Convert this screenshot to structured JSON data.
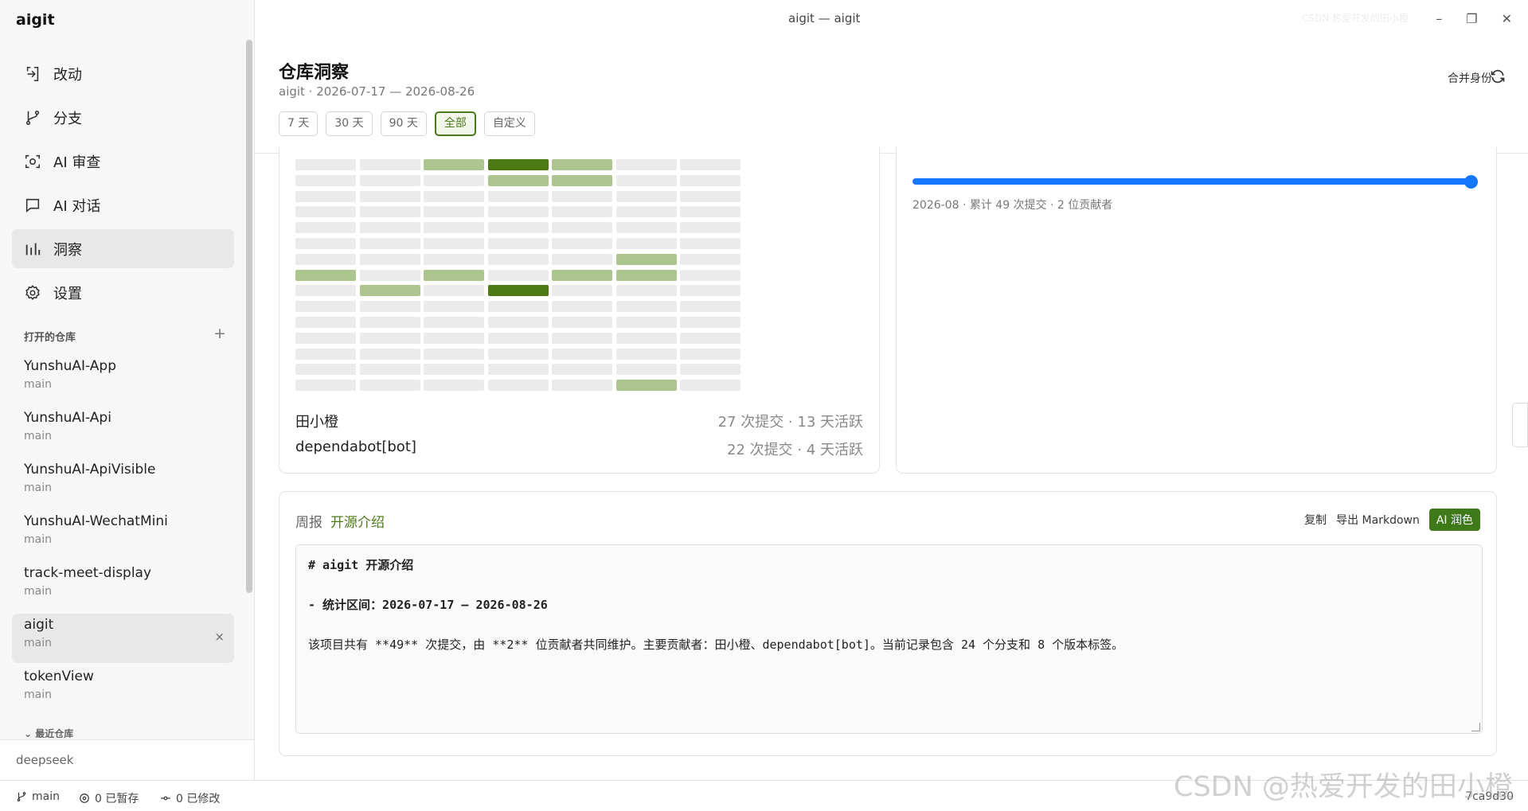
{
  "app": {
    "brand": "aigit",
    "window_title": "aigit — aigit",
    "ghost_text": "CSDN·热爱开发的田小橙"
  },
  "nav": [
    {
      "label": "改动",
      "icon": "changes-icon"
    },
    {
      "label": "分支",
      "icon": "branch-icon"
    },
    {
      "label": "AI 审查",
      "icon": "ai-review-icon"
    },
    {
      "label": "AI 对话",
      "icon": "chat-icon"
    },
    {
      "label": "洞察",
      "icon": "chart-icon",
      "active": true
    },
    {
      "label": "设置",
      "icon": "gear-icon"
    }
  ],
  "repos": {
    "heading": "打开的仓库",
    "add_label": "+",
    "items": [
      {
        "name": "YunshuAI-App",
        "branch": "main"
      },
      {
        "name": "YunshuAI-Api",
        "branch": "main"
      },
      {
        "name": "YunshuAI-ApiVisible",
        "branch": "main"
      },
      {
        "name": "YunshuAI-WechatMini",
        "branch": "main"
      },
      {
        "name": "track-meet-display",
        "branch": "main"
      },
      {
        "name": "aigit",
        "branch": "main",
        "active": true,
        "close": "×"
      },
      {
        "name": "tokenView",
        "branch": "main"
      }
    ],
    "recent": "最近仓库"
  },
  "model": "deepseek",
  "header": {
    "title": "仓库洞察",
    "subtitle": "aigit · 2026-07-17 — 2026-08-26",
    "ranges": [
      "7 天",
      "30 天",
      "90 天",
      "全部",
      "自定义"
    ],
    "active_range": 3,
    "identity": "合并身份"
  },
  "heatmap": {
    "colors": {
      "empty": "#ebebeb",
      "light": "#adc690",
      "dark": "#4c7a12"
    },
    "levels": [
      [
        0,
        0,
        1,
        2,
        1,
        0,
        0
      ],
      [
        0,
        0,
        0,
        1,
        1,
        0,
        0
      ],
      [
        0,
        0,
        0,
        0,
        0,
        0,
        0
      ],
      [
        0,
        0,
        0,
        0,
        0,
        0,
        0
      ],
      [
        0,
        0,
        0,
        0,
        0,
        0,
        0
      ],
      [
        0,
        0,
        0,
        0,
        0,
        0,
        0
      ],
      [
        0,
        0,
        0,
        0,
        0,
        1,
        0
      ],
      [
        1,
        0,
        1,
        0,
        1,
        1,
        0
      ],
      [
        0,
        1,
        0,
        2,
        0,
        0,
        0
      ],
      [
        0,
        0,
        0,
        0,
        0,
        0,
        0
      ],
      [
        0,
        0,
        0,
        0,
        0,
        0,
        0
      ],
      [
        0,
        0,
        0,
        0,
        0,
        0,
        0
      ],
      [
        0,
        0,
        0,
        0,
        0,
        0,
        0
      ],
      [
        0,
        0,
        0,
        0,
        0,
        0,
        0
      ],
      [
        0,
        0,
        0,
        0,
        0,
        1,
        0
      ]
    ]
  },
  "contributors": [
    {
      "name": "田小橙",
      "meta": "27 次提交 · 13 天活跃"
    },
    {
      "name": "dependabot[bot]",
      "meta": "22 次提交 · 4 天活跃"
    }
  ],
  "timeline": {
    "label": "2026-08 · 累计 49 次提交 · 2 位贡献者",
    "progress": 1.0,
    "color": "#1677ff"
  },
  "report": {
    "label": "周报",
    "title": "开源介绍",
    "copy": "复制",
    "export": "导出 Markdown",
    "ai": "AI 润色",
    "lines": [
      "# aigit 开源介绍",
      "- 统计区间：2026-07-17 — 2026-08-26",
      "该项目共有 **49** 次提交，由 **2** 位贡献者共同维护。主要贡献者：田小橙、dependabot[bot]。当前记录包含 24 个分支和 8 个版本标签。"
    ]
  },
  "status": {
    "branch": "main",
    "staged": "0 已暂存",
    "modified": "0 已修改",
    "hash": "7ca9d30"
  },
  "watermark": "CSDN @热爱开发的田小橙",
  "accent": "#4c7a1a"
}
